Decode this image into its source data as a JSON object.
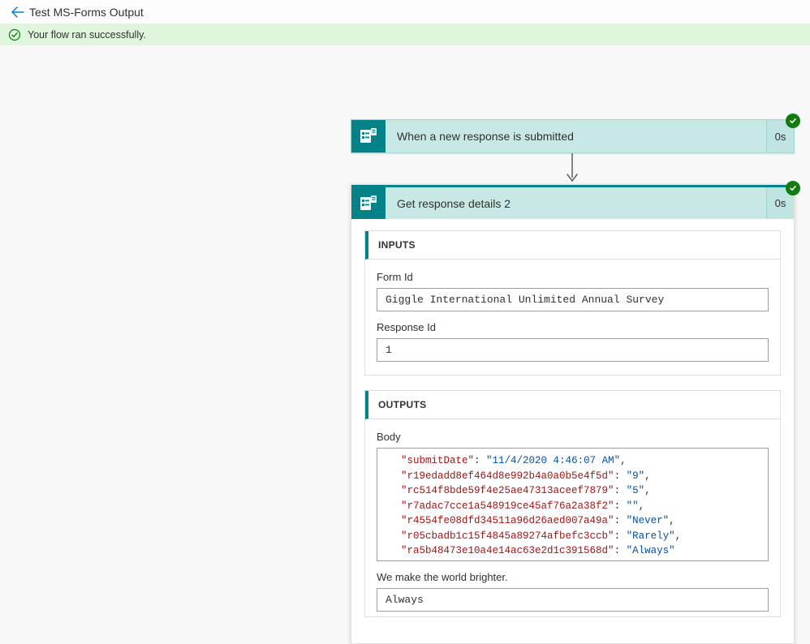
{
  "header": {
    "title": "Test MS-Forms Output"
  },
  "banner": {
    "message": "Your flow ran successfully."
  },
  "step1": {
    "title": "When a new response is submitted",
    "duration": "0s"
  },
  "step2": {
    "title": "Get response details 2",
    "duration": "0s"
  },
  "inputs": {
    "heading": "INPUTS",
    "formId": {
      "label": "Form Id",
      "value": "Giggle International Unlimited Annual Survey"
    },
    "responseId": {
      "label": "Response Id",
      "value": "1"
    }
  },
  "outputs": {
    "heading": "OUTPUTS",
    "body": {
      "label": "Body",
      "json": {
        "submitDate": "11/4/2020 4:46:07 AM",
        "r19edadd8ef464d8e992b4a0a0b5e4f5d": "9",
        "rc514f8bde59f4e25ae47313aceef7879": "5",
        "r7adac7cce1a548919ce45af76a2a38f2": "",
        "r4554fe08dfd34511a96d26aed007a49a": "Never",
        "r05cbadb1c15f4845a89274afbefc3ccb": "Rarely",
        "ra5b48473e10a4e14ac63e2d1c391568d": "Always"
      }
    },
    "brighter": {
      "label": "We make the world brighter.",
      "value": "Always"
    }
  }
}
